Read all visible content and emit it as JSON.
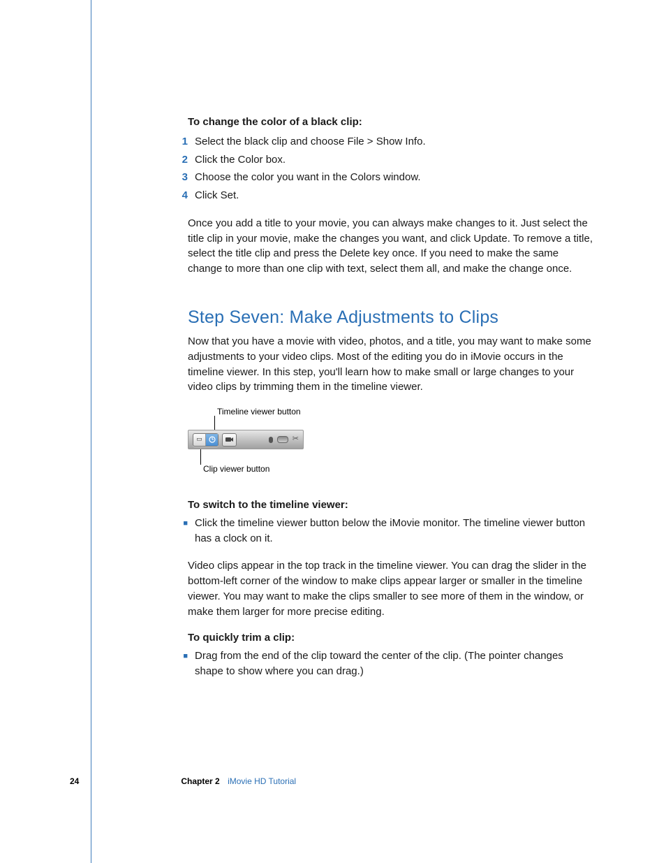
{
  "section1": {
    "subhead": "To change the color of a black clip:",
    "steps": [
      {
        "n": "1",
        "t": "Select the black clip and choose File > Show Info."
      },
      {
        "n": "2",
        "t": "Click the Color box."
      },
      {
        "n": "3",
        "t": "Choose the color you want in the Colors window."
      },
      {
        "n": "4",
        "t": "Click Set."
      }
    ],
    "paragraph": "Once you add a title to your movie, you can always make changes to it. Just select the title clip in your movie, make the changes you want, and click Update. To remove a title, select the title clip and press the Delete key once. If you need to make the same change to more than one clip with text, select them all, and make the change once."
  },
  "section2": {
    "heading": "Step Seven: Make Adjustments to Clips",
    "intro": "Now that you have a movie with video, photos, and a title, you may want to make some adjustments to your video clips. Most of the editing you do in iMovie occurs in the timeline viewer. In this step, you'll learn how to make small or large changes to your video clips by trimming them in the timeline viewer.",
    "sub1": "To switch to the timeline viewer:",
    "bullets1": [
      "Click the timeline viewer button below the iMovie monitor. The timeline viewer button has a clock on it."
    ],
    "para2": "Video clips appear in the top track in the timeline viewer. You can drag the slider in the bottom-left corner of the window to make clips appear larger or smaller in the timeline viewer. You may want to make the clips smaller to see more of them in the window, or make them larger for more precise editing.",
    "sub2": "To quickly trim a clip:",
    "bullets2": [
      "Drag from the end of the clip toward the center of the clip. (The pointer changes shape to show where you can drag.)"
    ]
  },
  "figure": {
    "callout_top": "Timeline viewer button",
    "callout_bottom": "Clip viewer button"
  },
  "footer": {
    "page": "24",
    "chapter": "Chapter 2",
    "title": "iMovie HD Tutorial"
  }
}
